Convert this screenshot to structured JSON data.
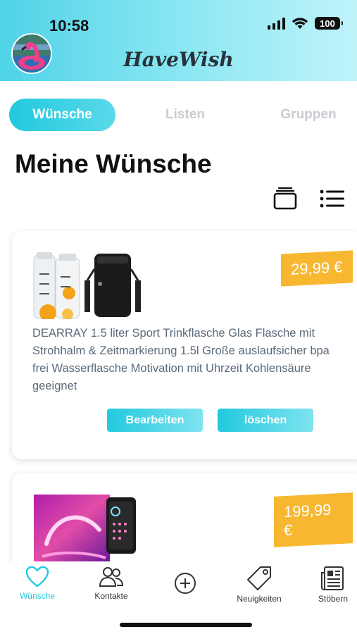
{
  "status_bar": {
    "time": "10:58",
    "battery": "100"
  },
  "header": {
    "app_title": "HaveWish"
  },
  "tabs": [
    {
      "label": "Wünsche",
      "active": true
    },
    {
      "label": "Listen",
      "active": false
    },
    {
      "label": "Gruppen",
      "active": false
    }
  ],
  "page_title": "Meine Wünsche",
  "view_toggle": {
    "options": [
      "card-view-icon",
      "list-view-icon"
    ],
    "selected": "card-view-icon"
  },
  "wishes": [
    {
      "price": "29,99 €",
      "description": "DEARRAY 1.5 liter Sport Trinkflasche Glas Flasche mit Strohhalm & Zeitmarkierung 1.5l Große auslaufsicher bpa frei Wasserflasche Motivation mit Uhrzeit Kohlensäure geeignet",
      "edit_label": "Bearbeiten",
      "delete_label": "löschen"
    },
    {
      "price": "199,99 €"
    }
  ],
  "bottom_nav": [
    {
      "label": "Wünsche",
      "icon": "heart-icon",
      "active": true
    },
    {
      "label": "Kontakte",
      "icon": "people-icon",
      "active": false
    },
    {
      "label": "",
      "icon": "plus-circle-icon",
      "active": false
    },
    {
      "label": "Neuigkeiten",
      "icon": "tag-icon",
      "active": false
    },
    {
      "label": "Stöbern",
      "icon": "newspaper-icon",
      "active": false
    }
  ],
  "colors": {
    "accent": "#22c9de",
    "price_tag": "#f7b731",
    "inactive_tab": "#c9ccd0"
  }
}
